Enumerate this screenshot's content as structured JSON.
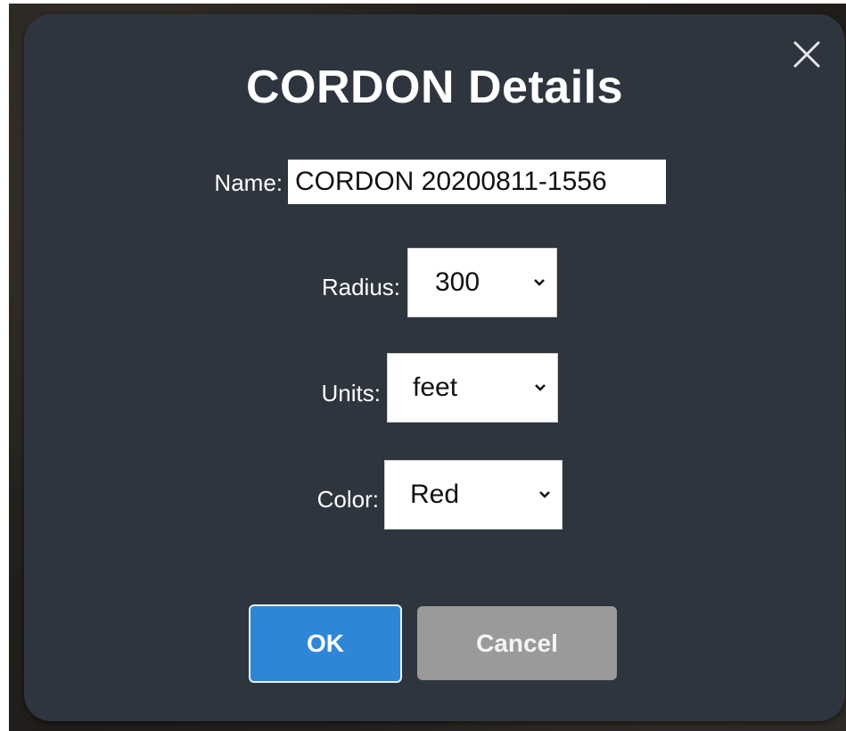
{
  "dialog": {
    "title": "CORDON Details",
    "close_icon": "close-icon"
  },
  "form": {
    "name_label": "Name:",
    "name_value": "CORDON 20200811-1556",
    "radius_label": "Radius:",
    "radius_value": "300",
    "units_label": "Units:",
    "units_value": "feet",
    "color_label": "Color:",
    "color_value": "Red"
  },
  "buttons": {
    "ok_label": "OK",
    "cancel_label": "Cancel"
  },
  "colors": {
    "dialog_bg": "#2e353e",
    "ok_bg": "#2f86d9",
    "cancel_bg": "#9a9a9a"
  }
}
